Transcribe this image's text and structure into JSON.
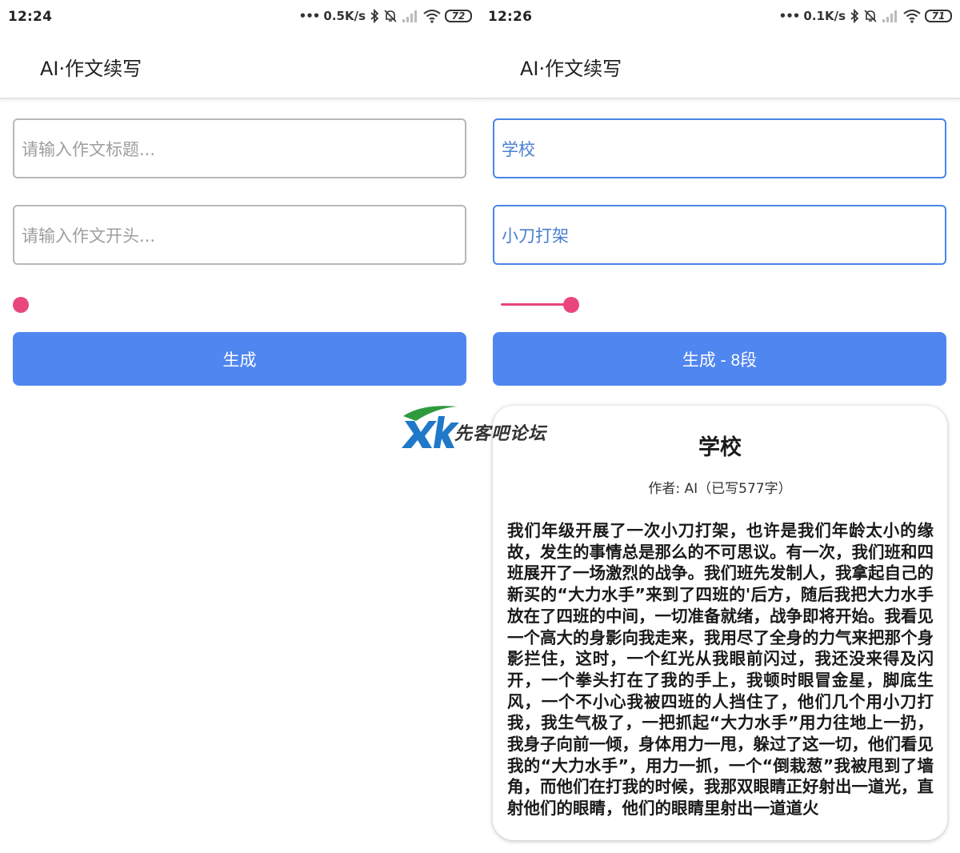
{
  "screens": [
    {
      "status": {
        "time": "12:24",
        "speed": "0.5K/s",
        "battery": "72"
      },
      "app_title": "AI·作文续写",
      "title_field": {
        "value": "",
        "placeholder": "请输入作文标题..."
      },
      "opening_field": {
        "value": "",
        "placeholder": "请输入作文开头..."
      },
      "slider": {
        "fraction": 0.0
      },
      "generate_label": "生成"
    },
    {
      "status": {
        "time": "12:26",
        "speed": "0.1K/s",
        "battery": "71"
      },
      "app_title": "AI·作文续写",
      "title_field": {
        "value": "学校",
        "placeholder": ""
      },
      "opening_field": {
        "value": "小刀打架",
        "placeholder": ""
      },
      "slider": {
        "fraction": 0.16
      },
      "generate_label": "生成 - 8段"
    }
  ],
  "essay": {
    "title": "学校",
    "meta": "作者: AI（已写577字）",
    "body": "我们年级开展了一次小刀打架，也许是我们年龄太小的缘故，发生的事情总是那么的不可思议。有一次，我们班和四班展开了一场激烈的战争。我们班先发制人，我拿起自己的新买的“大力水手”来到了四班的'后方，随后我把大力水手放在了四班的中间，一切准备就绪，战争即将开始。我看见一个高大的身影向我走来，我用尽了全身的力气来把那个身影拦住，这时，一个红光从我眼前闪过，我还没来得及闪开，一个拳头打在了我的手上，我顿时眼冒金星，脚底生风，一个不小心我被四班的人挡住了，他们几个用小刀打我，我生气极了，一把抓起“大力水手”用力往地上一扔，我身子向前一倾，身体用力一甩，躲过了这一切，他们看见我的“大力水手”，用力一抓，一个“倒栽葱”我被甩到了墙角，而他们在打我的时候，我那双眼睛正好射出一道光，直射他们的眼睛，他们的眼睛里射出一道道火"
  },
  "watermark": {
    "text": "先客吧论坛",
    "logo": "XK"
  },
  "colors": {
    "accent": "#5086f0",
    "slider": "#e8467c",
    "focused_border": "#4a86e8"
  },
  "icons": [
    "bluetooth-icon",
    "mute-icon",
    "signal-icon",
    "wifi-icon",
    "battery-icon"
  ]
}
